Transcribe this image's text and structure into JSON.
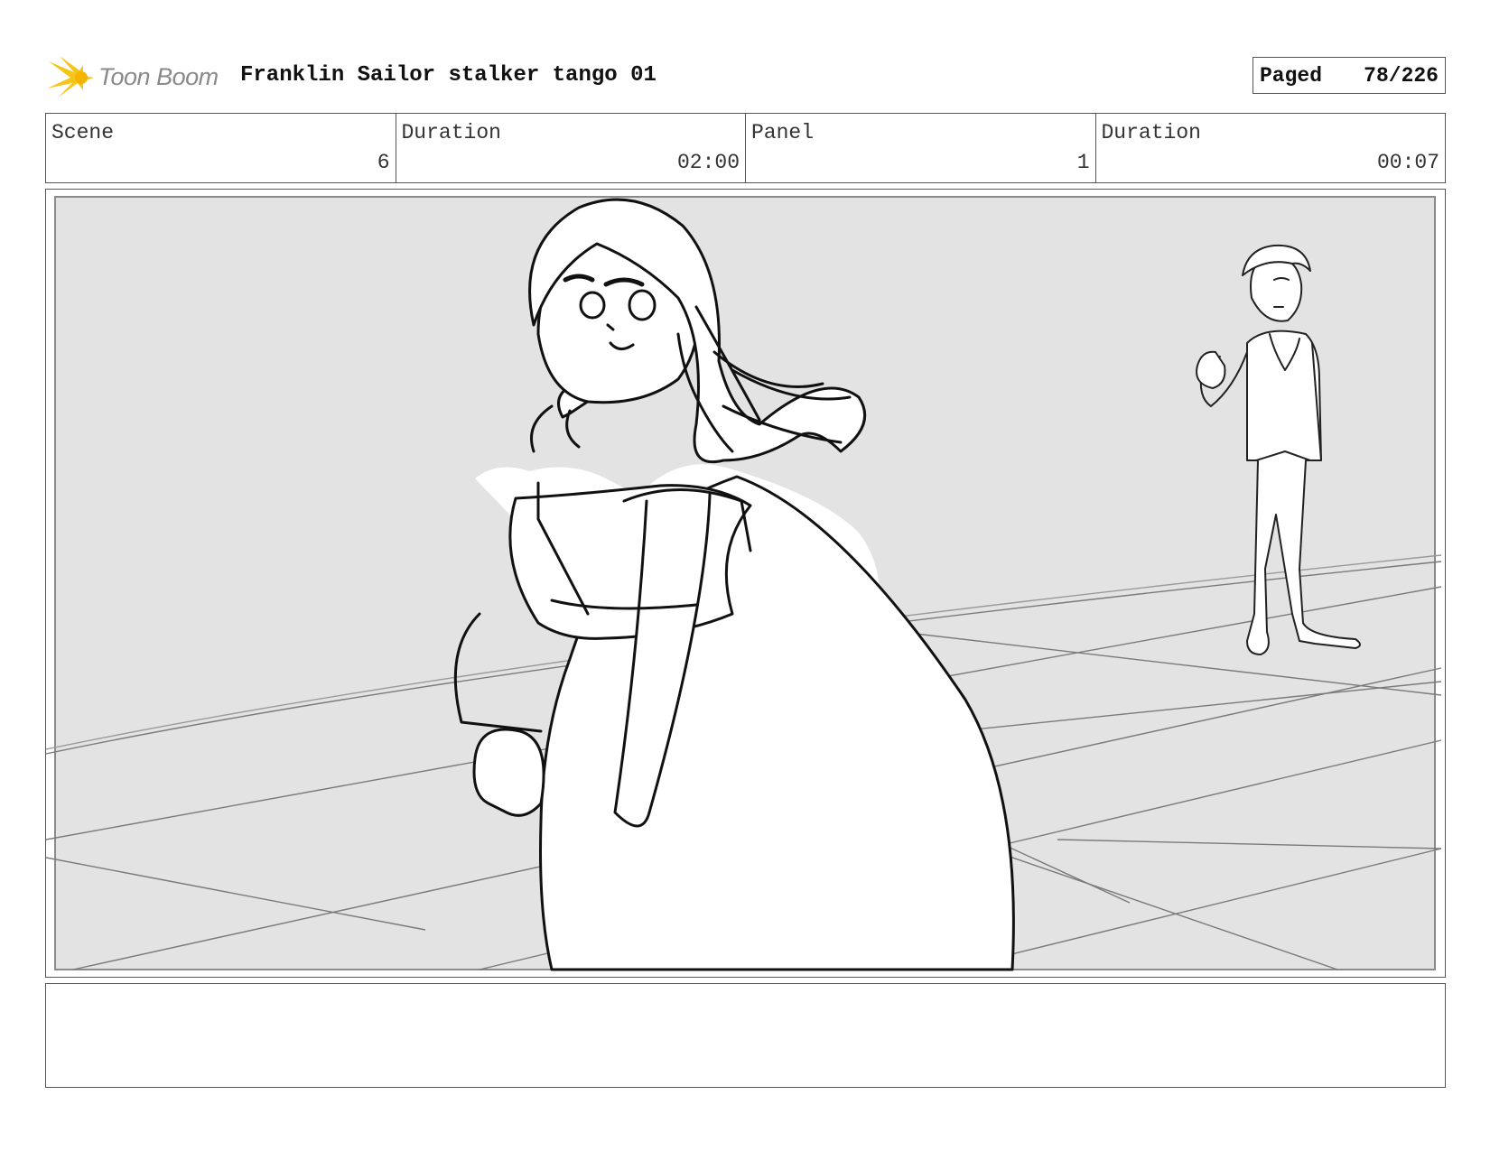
{
  "header": {
    "logo_text": "Toon Boom",
    "title": "Franklin Sailor stalker tango 01",
    "paged_label": "Paged",
    "page_counter": "78/226"
  },
  "info": {
    "scene_label": "Scene",
    "scene_value": "6",
    "scene_duration_label": "Duration",
    "scene_duration_value": "02:00",
    "panel_label": "Panel",
    "panel_value": "1",
    "panel_duration_label": "Duration",
    "panel_duration_value": "00:07"
  },
  "notes": {
    "text": ""
  },
  "colors": {
    "logo_star": "#f5c518",
    "panel_background": "#e3e3e3",
    "border": "#555555"
  }
}
